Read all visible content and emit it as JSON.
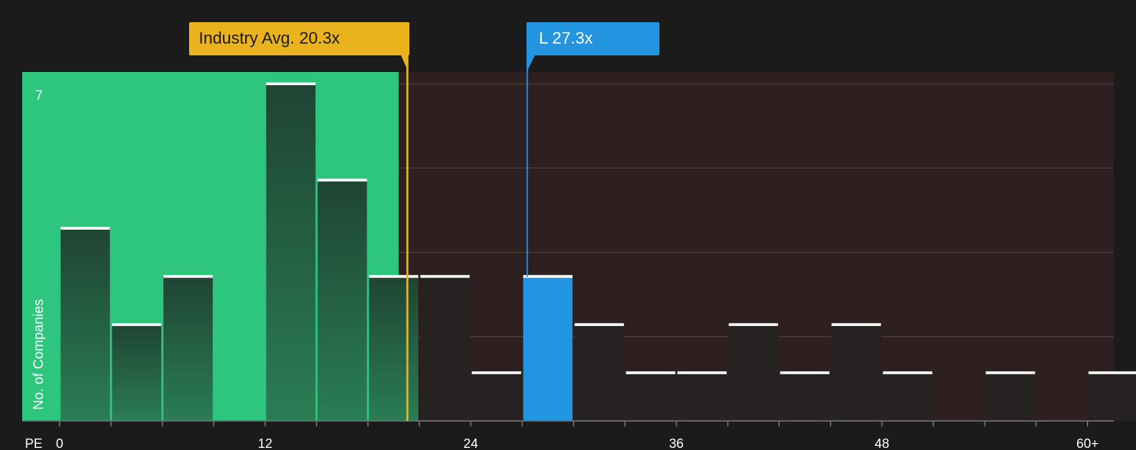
{
  "chart_data": {
    "type": "bar",
    "title": "",
    "xlabel": "PE",
    "ylabel": "No. of Companies",
    "ylim": [
      0,
      7
    ],
    "y_top_tick_label": "7",
    "x_ticks": [
      {
        "value": 0,
        "label": "0"
      },
      {
        "value": 12,
        "label": "12"
      },
      {
        "value": 24,
        "label": "24"
      },
      {
        "value": 36,
        "label": "36"
      },
      {
        "value": 48,
        "label": "48"
      },
      {
        "value": 60,
        "label": "60+"
      }
    ],
    "bins": [
      {
        "x0": 0,
        "x1": 3,
        "count": 4
      },
      {
        "x0": 3,
        "x1": 6,
        "count": 2
      },
      {
        "x0": 6,
        "x1": 9,
        "count": 3
      },
      {
        "x0": 9,
        "x1": 12,
        "count": 0
      },
      {
        "x0": 12,
        "x1": 15,
        "count": 7
      },
      {
        "x0": 15,
        "x1": 18,
        "count": 5
      },
      {
        "x0": 18,
        "x1": 21,
        "count": 3
      },
      {
        "x0": 21,
        "x1": 24,
        "count": 3
      },
      {
        "x0": 24,
        "x1": 27,
        "count": 1
      },
      {
        "x0": 27,
        "x1": 30,
        "count": 3,
        "highlight": true
      },
      {
        "x0": 30,
        "x1": 33,
        "count": 2
      },
      {
        "x0": 33,
        "x1": 36,
        "count": 1
      },
      {
        "x0": 36,
        "x1": 39,
        "count": 1
      },
      {
        "x0": 39,
        "x1": 42,
        "count": 2
      },
      {
        "x0": 42,
        "x1": 45,
        "count": 1
      },
      {
        "x0": 45,
        "x1": 48,
        "count": 2
      },
      {
        "x0": 48,
        "x1": 51,
        "count": 1
      },
      {
        "x0": 51,
        "x1": 54,
        "count": 0
      },
      {
        "x0": 54,
        "x1": 57,
        "count": 1
      },
      {
        "x0": 57,
        "x1": 60,
        "count": 0
      },
      {
        "x0": 60,
        "x1": 63,
        "count": 1
      }
    ],
    "industry_avg": {
      "value": 20.3,
      "label": "Industry Avg. 20.3x"
    },
    "company": {
      "value": 27.3,
      "label": "L 27.3x"
    },
    "fair_zone_end": 19.8,
    "grid": true,
    "colors": {
      "undervalued_zone": "#2ec67f",
      "overvalued_zone": "#2e1f20",
      "bar_in_zone": "#1f4a36",
      "bar_out_zone": "#272222",
      "bar_cap": "#ffffff",
      "highlight_bar": "#2394e0",
      "industry_line": "#eab21c",
      "company_line": "#2394e0",
      "background": "#1b1b1b"
    }
  }
}
